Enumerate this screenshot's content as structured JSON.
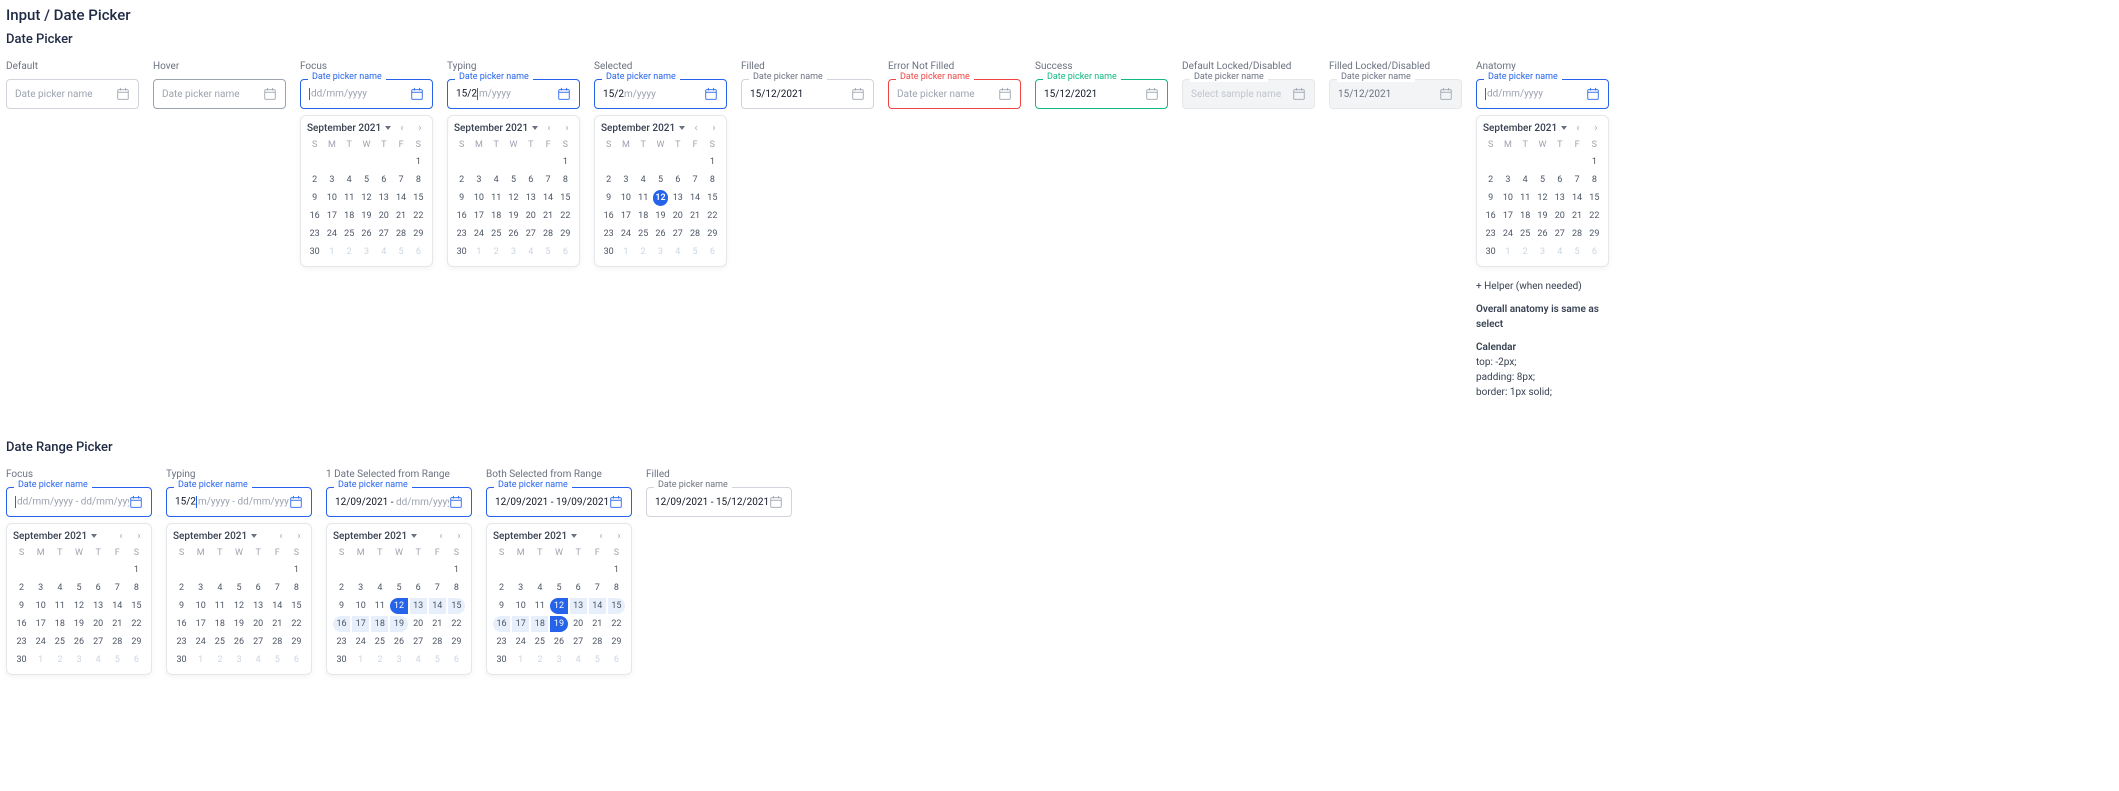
{
  "page_title": "Input / Date Picker",
  "section1_title": "Date Picker",
  "section2_title": "Date Range Picker",
  "placeholder_single": "dd/mm/yyyy",
  "placeholder_range": "dd/mm/yyyy - dd/mm/yyyy",
  "typed_prefix": "15/2",
  "typed_suffix": "m/yyyy",
  "typed_range_suffix": "m/yyyy - dd/mm/yyyy",
  "filled_date": "15/12/2021",
  "range1_value": "12/09/2021 - ",
  "range2_value": "12/09/2021 - 19/09/2021",
  "range_filled_value": "12/09/2021 - 15/12/2021",
  "disabled_placeholder": "Select sample name",
  "float_label": "Date picker name",
  "states": {
    "default": "Default",
    "hover": "Hover",
    "focus": "Focus",
    "typing": "Typing",
    "selected": "Selected",
    "filled": "Filled",
    "error": "Error Not Filled",
    "success": "Success",
    "locked_default": "Default Locked/Disabled",
    "locked_filled": "Filled Locked/Disabled",
    "anatomy": "Anatomy",
    "range_focus": "Focus",
    "range_typing": "Typing",
    "range_one": "1 Date Selected from Range",
    "range_both": "Both Selected from Range",
    "range_filled": "Filled"
  },
  "calendar": {
    "month_label": "September 2021",
    "dow": [
      "S",
      "M",
      "T",
      "W",
      "T",
      "F",
      "S"
    ],
    "prev_trail": [
      1
    ],
    "days": [
      1,
      2,
      3,
      4,
      5,
      6,
      7,
      8,
      9,
      10,
      11,
      12,
      13,
      14,
      15,
      16,
      17,
      18,
      19,
      20,
      21,
      22,
      23,
      24,
      25,
      26,
      27,
      28,
      29,
      30
    ],
    "next_trail": [
      1,
      2,
      3,
      4,
      5,
      6
    ],
    "selected_single": 12,
    "range1": {
      "start": 12,
      "end": 19,
      "highlight": [
        12,
        13,
        14,
        15,
        16,
        17,
        18,
        19
      ]
    },
    "range2": {
      "start": 12,
      "end": 19,
      "highlight": [
        12,
        13,
        14,
        15,
        16,
        17,
        18,
        19
      ]
    }
  },
  "anatomy_notes": {
    "helper": "+ Helper (when needed)",
    "line1": "Overall anatomy is same as select",
    "cal_heading": "Calendar",
    "l_top": "top: -2px;",
    "l_pad": "padding: 8px;",
    "l_bor": "border: 1px solid;"
  }
}
